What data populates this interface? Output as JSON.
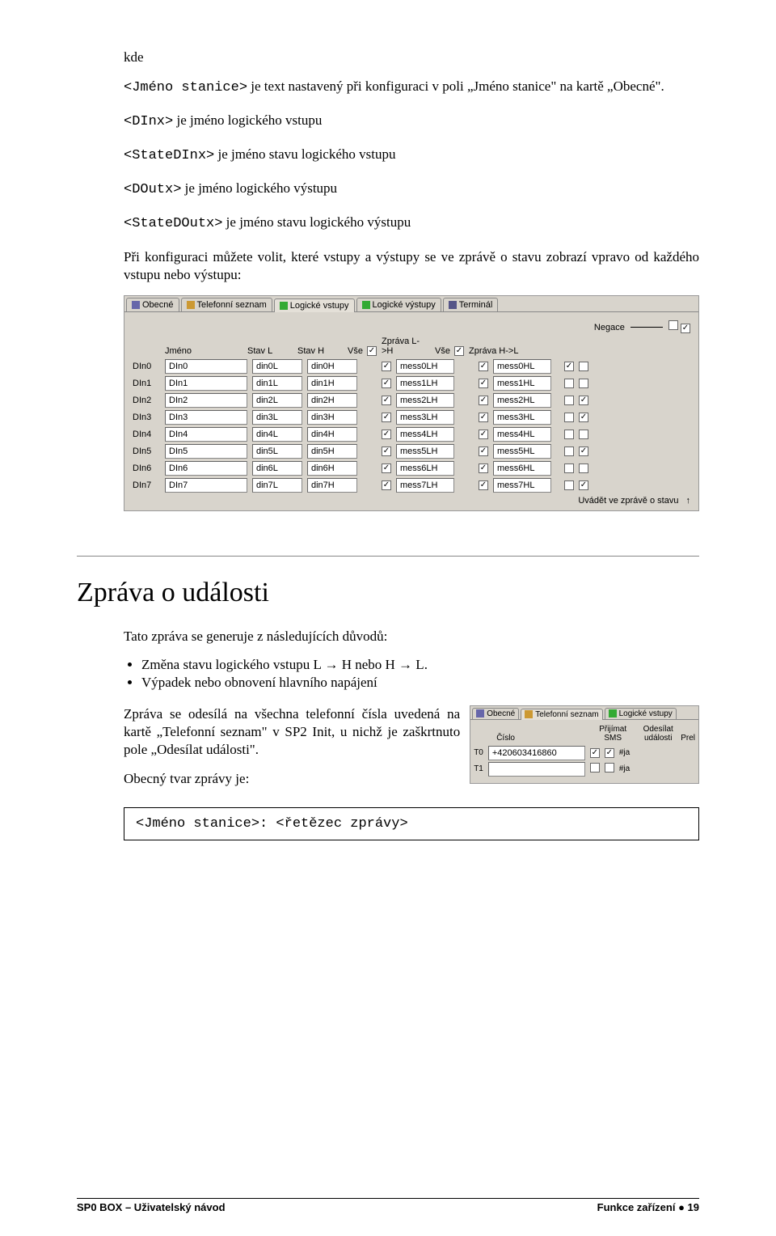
{
  "intro": {
    "kde": "kde",
    "p1_a": "<Jméno stanice>",
    "p1_b": " je text nastavený při konfiguraci v poli „Jméno stanice\" na kartě „Obecné\".",
    "p2_a": "<DInx>",
    "p2_b": " je jméno logického vstupu",
    "p3_a": "<StateDInx>",
    "p3_b": " je jméno stavu logického vstupu",
    "p4_a": "<DOutx>",
    "p4_b": " je jméno logického výstupu",
    "p5_a": "<StateDOutx>",
    "p5_b": " je jméno stavu logického výstupu",
    "p6": "Při konfiguraci můžete volit, které vstupy a výstupy se ve zprávě o stavu zobrazí vpravo od každého vstupu nebo výstupu:"
  },
  "panel1": {
    "tabs": [
      "Obecné",
      "Telefonní seznam",
      "Logické vstupy",
      "Logické výstupy",
      "Terminál"
    ],
    "active_tab": 2,
    "negace": "Negace",
    "headers": {
      "jmeno": "Jméno",
      "stavL": "Stav L",
      "stavH": "Stav H",
      "vse1": "Vše",
      "zlh": "Zpráva L->H",
      "vse2": "Vše",
      "zhl": "Zpráva H->L"
    },
    "rows": [
      {
        "id": "DIn0",
        "jm": "DIn0",
        "sl": "din0L",
        "sh": "din0H",
        "c1": true,
        "m1": "mess0LH",
        "c2": true,
        "m2": "mess0HL",
        "n1": true,
        "n2": false
      },
      {
        "id": "DIn1",
        "jm": "DIn1",
        "sl": "din1L",
        "sh": "din1H",
        "c1": true,
        "m1": "mess1LH",
        "c2": true,
        "m2": "mess1HL",
        "n1": false,
        "n2": false
      },
      {
        "id": "DIn2",
        "jm": "DIn2",
        "sl": "din2L",
        "sh": "din2H",
        "c1": true,
        "m1": "mess2LH",
        "c2": true,
        "m2": "mess2HL",
        "n1": false,
        "n2": true
      },
      {
        "id": "DIn3",
        "jm": "DIn3",
        "sl": "din3L",
        "sh": "din3H",
        "c1": true,
        "m1": "mess3LH",
        "c2": true,
        "m2": "mess3HL",
        "n1": false,
        "n2": true
      },
      {
        "id": "DIn4",
        "jm": "DIn4",
        "sl": "din4L",
        "sh": "din4H",
        "c1": true,
        "m1": "mess4LH",
        "c2": true,
        "m2": "mess4HL",
        "n1": false,
        "n2": false
      },
      {
        "id": "DIn5",
        "jm": "DIn5",
        "sl": "din5L",
        "sh": "din5H",
        "c1": true,
        "m1": "mess5LH",
        "c2": true,
        "m2": "mess5HL",
        "n1": false,
        "n2": true
      },
      {
        "id": "DIn6",
        "jm": "DIn6",
        "sl": "din6L",
        "sh": "din6H",
        "c1": true,
        "m1": "mess6LH",
        "c2": true,
        "m2": "mess6HL",
        "n1": false,
        "n2": false
      },
      {
        "id": "DIn7",
        "jm": "DIn7",
        "sl": "din7L",
        "sh": "din7H",
        "c1": true,
        "m1": "mess7LH",
        "c2": true,
        "m2": "mess7HL",
        "n1": false,
        "n2": true
      }
    ],
    "foot": "Uvádět ve zprávě o stavu"
  },
  "section": {
    "title": "Zpráva o události",
    "p1": "Tato zpráva se generuje z následujících důvodů:",
    "b1": "Změna stavu logického vstupu L → H nebo H → L.",
    "b2": "Výpadek nebo obnovení hlavního napájení",
    "p2": "Zpráva se odesílá na všechna telefonní čísla uvedená na kartě „Telefonní seznam\" v SP2 Init, u nichž je zaškrtnuto pole „Odesílat události\".",
    "p3": "Obecný tvar zprávy je:",
    "code": "<Jméno stanice>: <řetězec zprávy>"
  },
  "panel2": {
    "tabs": [
      "Obecné",
      "Telefonní seznam",
      "Logické vstupy"
    ],
    "active_tab": 1,
    "headers": {
      "cislo": "Číslo",
      "prijimat": "Přijímat SMS",
      "odesilat": "Odesílat události",
      "prel": "Prel"
    },
    "rows": [
      {
        "id": "T0",
        "num": "+420603416860",
        "c1": true,
        "c2": true,
        "prel": "#ja"
      },
      {
        "id": "T1",
        "num": "",
        "c1": false,
        "c2": false,
        "prel": "#ja"
      }
    ]
  },
  "footer": {
    "left": "SP0 BOX – Uživatelský návod",
    "right": "Funkce zařízení ● 19"
  }
}
